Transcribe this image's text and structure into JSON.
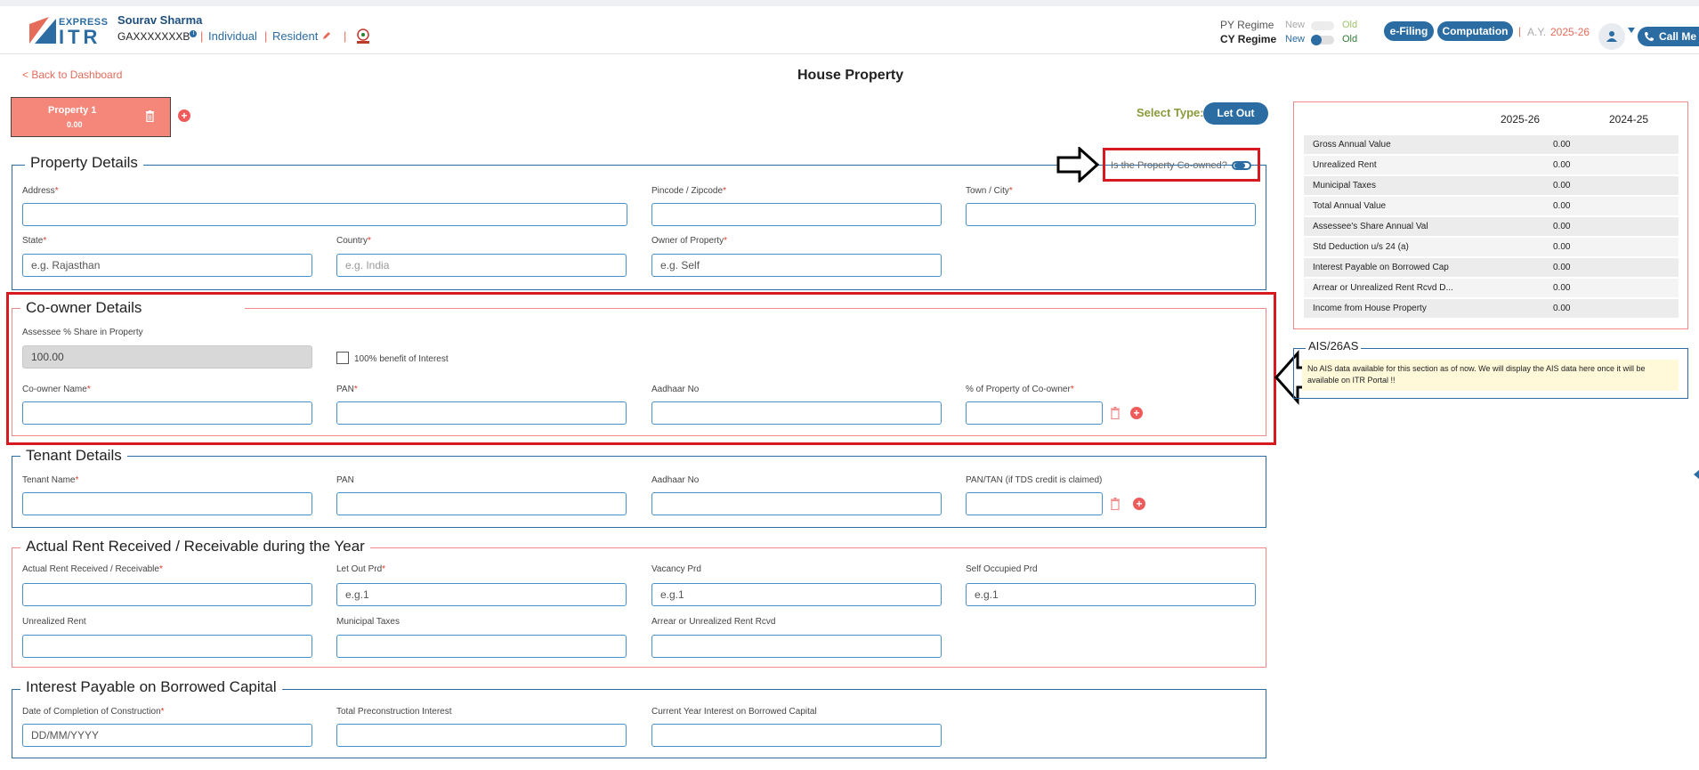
{
  "header": {
    "logo_express": "EXPRESS",
    "logo_itr": "ITR",
    "user_name": "Sourav Sharma",
    "pan": "GAXXXXXXXB",
    "status_individual": "Individual",
    "status_resident": "Resident",
    "py_regime": "PY Regime",
    "cy_regime": "CY Regime",
    "new": "New",
    "old": "Old",
    "efiling": "e-Filing",
    "computation": "Computation",
    "ay_label": "A.Y.",
    "ay_value": "2025-26",
    "call_me": "Call Me"
  },
  "nav": {
    "back": "< Back to Dashboard",
    "page_title": "House Property"
  },
  "property_tab": {
    "name": "Property 1",
    "amount": "0.00",
    "select_type_label": "Select Type:",
    "select_type_value": "Let Out"
  },
  "property_details": {
    "title": "Property Details",
    "coowned_label": "Is the Property Co-owned?",
    "address_label": "Address",
    "pincode_label": "Pincode / Zipcode",
    "town_label": "Town / City",
    "state_label": "State",
    "state_placeholder": "e.g. Rajasthan",
    "country_label": "Country",
    "country_placeholder": "e.g. India",
    "owner_label": "Owner of Property",
    "owner_placeholder": "e.g. Self"
  },
  "coowner": {
    "title": "Co-owner Details",
    "share_label": "Assessee % Share in Property",
    "share_value": "100.00",
    "benefit_label": "100% benefit of Interest",
    "name_label": "Co-owner Name",
    "pan_label": "PAN",
    "aadhaar_label": "Aadhaar No",
    "pct_label": "% of Property of Co-owner"
  },
  "tenant": {
    "title": "Tenant Details",
    "name_label": "Tenant Name",
    "pan_label": "PAN",
    "aadhaar_label": "Aadhaar No",
    "pantan_label": "PAN/TAN (if TDS credit is claimed)"
  },
  "rent": {
    "title": "Actual Rent Received / Receivable during the Year",
    "actual_label": "Actual Rent Received / Receivable",
    "letout_label": "Let Out Prd",
    "letout_placeholder": "e.g.1",
    "vacancy_label": "Vacancy Prd",
    "vacancy_placeholder": "e.g.1",
    "self_label": "Self Occupied Prd",
    "self_placeholder": "e.g.1",
    "unrealized_label": "Unrealized Rent",
    "municipal_label": "Municipal Taxes",
    "arrear_label": "Arrear or Unrealized Rent Rcvd"
  },
  "interest": {
    "title": "Interest Payable on Borrowed Capital",
    "date_label": "Date of Completion of Construction",
    "date_placeholder": "DD/MM/YYYY",
    "precon_label": "Total Preconstruction Interest",
    "current_label": "Current Year Interest on Borrowed Capital"
  },
  "summary": {
    "col1": "2025-26",
    "col2": "2024-25",
    "rows": [
      {
        "label": "Gross Annual Value",
        "value": "0.00"
      },
      {
        "label": "Unrealized Rent",
        "value": "0.00"
      },
      {
        "label": "Municipal Taxes",
        "value": "0.00"
      },
      {
        "label": "Total Annual Value",
        "value": "0.00"
      },
      {
        "label": "Assessee's Share Annual Val",
        "value": "0.00"
      },
      {
        "label": "Std Deduction u/s 24 (a)",
        "value": "0.00"
      },
      {
        "label": "Interest Payable on Borrowed Cap",
        "value": "0.00"
      },
      {
        "label": "Arrear or Unrealized Rent Rcvd D...",
        "value": "0.00"
      },
      {
        "label": "Income from House Property",
        "value": "0.00"
      }
    ]
  },
  "ais": {
    "title": "AIS/26AS",
    "message": "No AIS data available for this section as of now. We will display the AIS data here once it will be available on ITR Portal !!"
  },
  "colors": {
    "brand_blue": "#2b6ca3",
    "accent_red": "#e56b5b",
    "highlight": "#d71920"
  }
}
